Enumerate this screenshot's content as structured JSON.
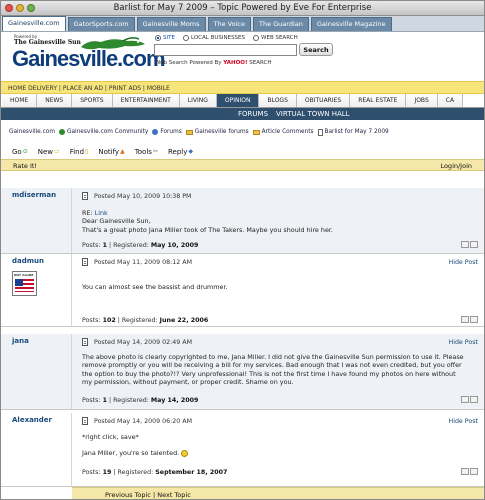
{
  "window": {
    "title": "Barlist for May 7 2009 – Topic Powered by Eve For Enterprise"
  },
  "tabs": [
    "Gainesville.com",
    "GatorSports.com",
    "Gainesville Moms",
    "The Voice",
    "The Guardian",
    "Gainesville Magazine"
  ],
  "header": {
    "powered": "Powered by",
    "logo_sub": "The Gainesville Sun",
    "logo": "Gainesville.com",
    "search_options": [
      "SITE",
      "LOCAL BUSINESSES",
      "WEB SEARCH"
    ],
    "search_placeholder": "",
    "search_button": "Search",
    "web_search_prefix": "Web Search Powered By ",
    "web_search_brand": "YAHOO!",
    "web_search_suffix": " SEARCH"
  },
  "yellowbar": "HOME DELIVERY | PLACE AN AD | PRINT ADS | MOBILE",
  "nav": [
    "HOME",
    "NEWS",
    "SPORTS",
    "ENTERTAINMENT",
    "LIVING",
    "OPINION",
    "BLOGS",
    "OBITUARIES",
    "REAL ESTATE",
    "JOBS",
    "CA"
  ],
  "subnav": {
    "left": "FORUMS",
    "right": "VIRTUAL TOWN HALL"
  },
  "breadcrumb": [
    "Gainesville.com",
    "Gainesville.com Community",
    "Forums",
    "Gainesville forums",
    "Article Comments",
    "Barlist for May 7 2009"
  ],
  "toolbar": [
    "Go",
    "New",
    "Find",
    "Notify",
    "Tools",
    "Reply"
  ],
  "rate": {
    "left": "Rate It!",
    "right": "Login/Join"
  },
  "posts": [
    {
      "author": "mdiserman",
      "posted": "Posted May 10, 2009 10:38 PM",
      "hide": "",
      "re": "RE: ",
      "re_link": "Link",
      "lines": [
        "Dear Gainesville Sun,",
        "That's a great photo Jana Miller took of The Takers. Maybe you should hire her."
      ],
      "posts_label": "Posts: ",
      "posts_count": "1",
      "reg_label": " | Registered: ",
      "reg_date": "May 10, 2009"
    },
    {
      "author": "dadmun",
      "posted": "Posted May 11, 2009 08:12 AM",
      "hide": "Hide Post",
      "lines": [
        "You can almost see the bassist and drummer."
      ],
      "posts_label": "Posts: ",
      "posts_count": "102",
      "reg_label": " | Registered: ",
      "reg_date": "June 22, 2006",
      "avatar_label": "NOT ALONE"
    },
    {
      "author": "jana",
      "posted": "Posted May 14, 2009 02:49 AM",
      "hide": "Hide Post",
      "lines": [
        "The above photo is clearly copyrighted to me, Jana Miller. I did not give the Gainesville Sun permission to use it. Please remove promptly or you will be receiving a bill for my services. Bad enough that I was not even credited, but you offer the option to buy the photo?!? Very unprofessional! This is not the first time I have found my photos on here without my permission, without payment, or proper credit. Shame on you."
      ],
      "posts_label": "Posts: ",
      "posts_count": "1",
      "reg_label": " | Registered: ",
      "reg_date": "May 14, 2009"
    },
    {
      "author": "Alexander",
      "posted": "Posted May 14, 2009 06:20 AM",
      "hide": "Hide Post",
      "lines": [
        "*right click, save*",
        "Jana Miller, you're so talented."
      ],
      "posts_label": "Posts: ",
      "posts_count": "19",
      "reg_label": " | Registered: ",
      "reg_date": "September 18, 2007"
    }
  ],
  "footer": {
    "prev": "Previous Topic",
    "sep": " | ",
    "next": "Next Topic"
  }
}
